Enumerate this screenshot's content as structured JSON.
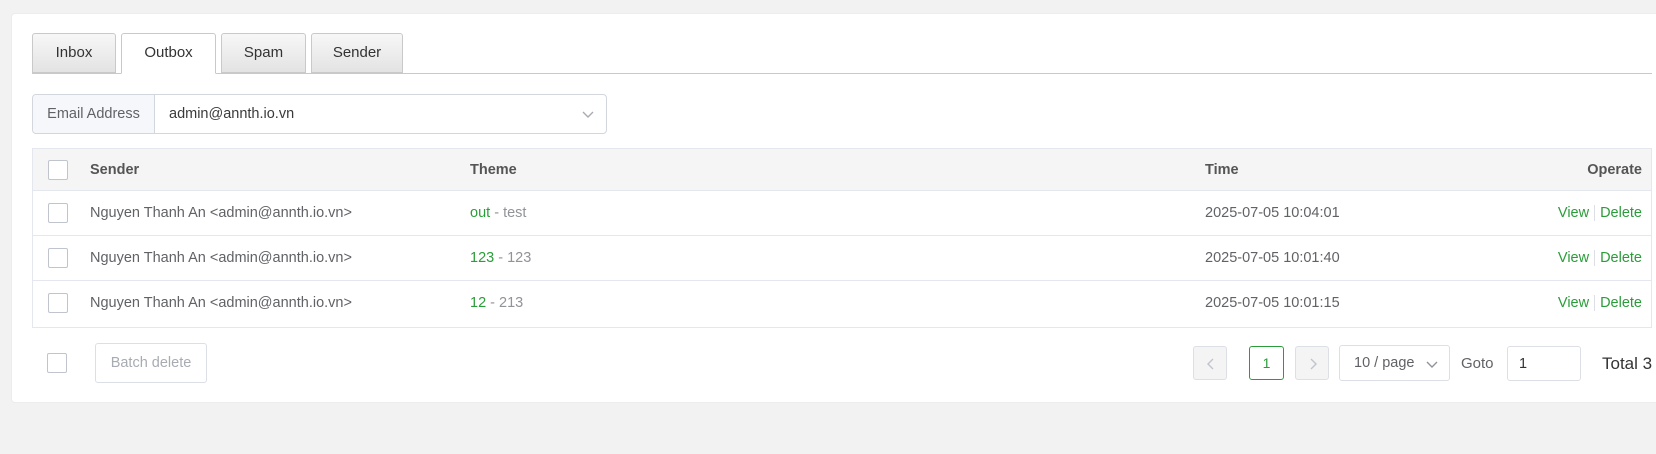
{
  "tabs": [
    {
      "label": "Inbox",
      "active": false
    },
    {
      "label": "Outbox",
      "active": true
    },
    {
      "label": "Spam",
      "active": false
    },
    {
      "label": "Sender",
      "active": false
    }
  ],
  "email_filter": {
    "label": "Email Address",
    "value": "admin@annth.io.vn"
  },
  "table": {
    "columns": {
      "sender": "Sender",
      "theme": "Theme",
      "time": "Time",
      "operate": "Operate"
    },
    "rows": [
      {
        "sender": "Nguyen Thanh An <admin@annth.io.vn>",
        "subject": "out",
        "separator": " - ",
        "preview": "test",
        "time": "2025-07-05 10:04:01",
        "view": "View",
        "delete": "Delete"
      },
      {
        "sender": "Nguyen Thanh An <admin@annth.io.vn>",
        "subject": "123",
        "separator": " - ",
        "preview": "123",
        "time": "2025-07-05 10:01:40",
        "view": "View",
        "delete": "Delete"
      },
      {
        "sender": "Nguyen Thanh An <admin@annth.io.vn>",
        "subject": "12",
        "separator": " - ",
        "preview": "213",
        "time": "2025-07-05 10:01:15",
        "view": "View",
        "delete": "Delete"
      }
    ]
  },
  "footer": {
    "batch_delete": "Batch delete",
    "current_page": "1",
    "page_size": "10 / page",
    "goto_label": "Goto",
    "goto_value": "1",
    "total": "Total 3"
  },
  "colors": {
    "accent": "#2a9d3a",
    "background": "#f2f2f2"
  },
  "icons": [
    "chevron-down-icon",
    "chevron-left-icon",
    "chevron-right-icon"
  ]
}
